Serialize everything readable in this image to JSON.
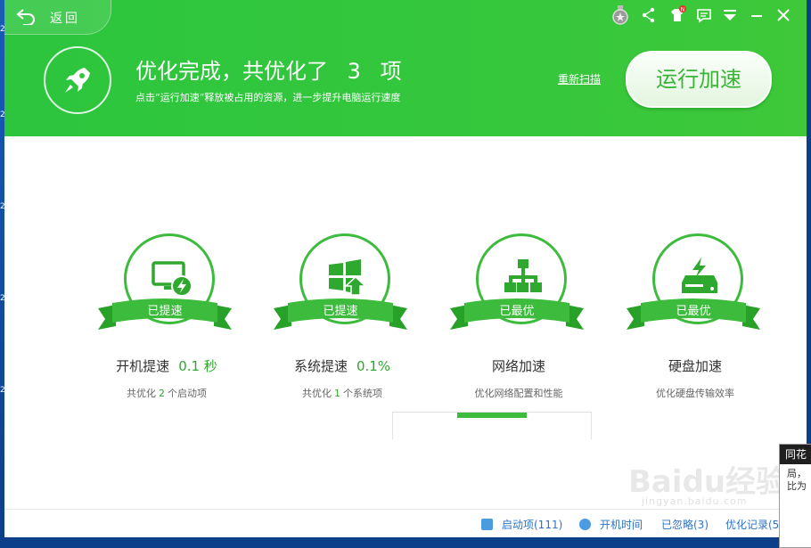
{
  "header": {
    "back_label": "返回",
    "headline_prefix": "优化完成，共优化了",
    "headline_count": "3",
    "headline_suffix": "项",
    "subline": "点击“运行加速”释放被占用的资源，进一步提升电脑运行速度",
    "rescan_label": "重新扫描",
    "run_button_label": "运行加速",
    "notification_badge": "N"
  },
  "cards": [
    {
      "icon": "monitor-bolt-icon",
      "badge": "已提速",
      "title": "开机提速",
      "value": "0.1 秒",
      "sub_prefix": "共优化",
      "sub_num": "2",
      "sub_suffix": "个启动项"
    },
    {
      "icon": "windows-upgrade-icon",
      "badge": "已提速",
      "title": "系统提速",
      "value": "0.1%",
      "sub_prefix": "共优化",
      "sub_num": "1",
      "sub_suffix": "个系统项"
    },
    {
      "icon": "network-icon",
      "badge": "已最优",
      "title": "网络加速",
      "value": "",
      "sub_prefix": "优化网络配置和性能",
      "sub_num": "",
      "sub_suffix": ""
    },
    {
      "icon": "hard-disk-icon",
      "badge": "已最优",
      "title": "硬盘加速",
      "value": "",
      "sub_prefix": "优化硬盘传输效率",
      "sub_num": "",
      "sub_suffix": ""
    }
  ],
  "footer": {
    "startup_items": "启动项(111)",
    "boot_time": "开机时间",
    "ignored": "已忽略(3)",
    "history": "优化记录(5"
  },
  "popup": {
    "title": "同花",
    "line1": "局，",
    "line2": "比为"
  },
  "watermark": {
    "text": "Baidu经验",
    "sub": "jingyan.baidu.com"
  },
  "desktop": {
    "marks": [
      "2",
      "2",
      "2",
      "2",
      "2"
    ]
  },
  "colors": {
    "brand_green": "#34c73d",
    "accent_green": "#2fa82f",
    "link_blue": "#2c74c9"
  }
}
